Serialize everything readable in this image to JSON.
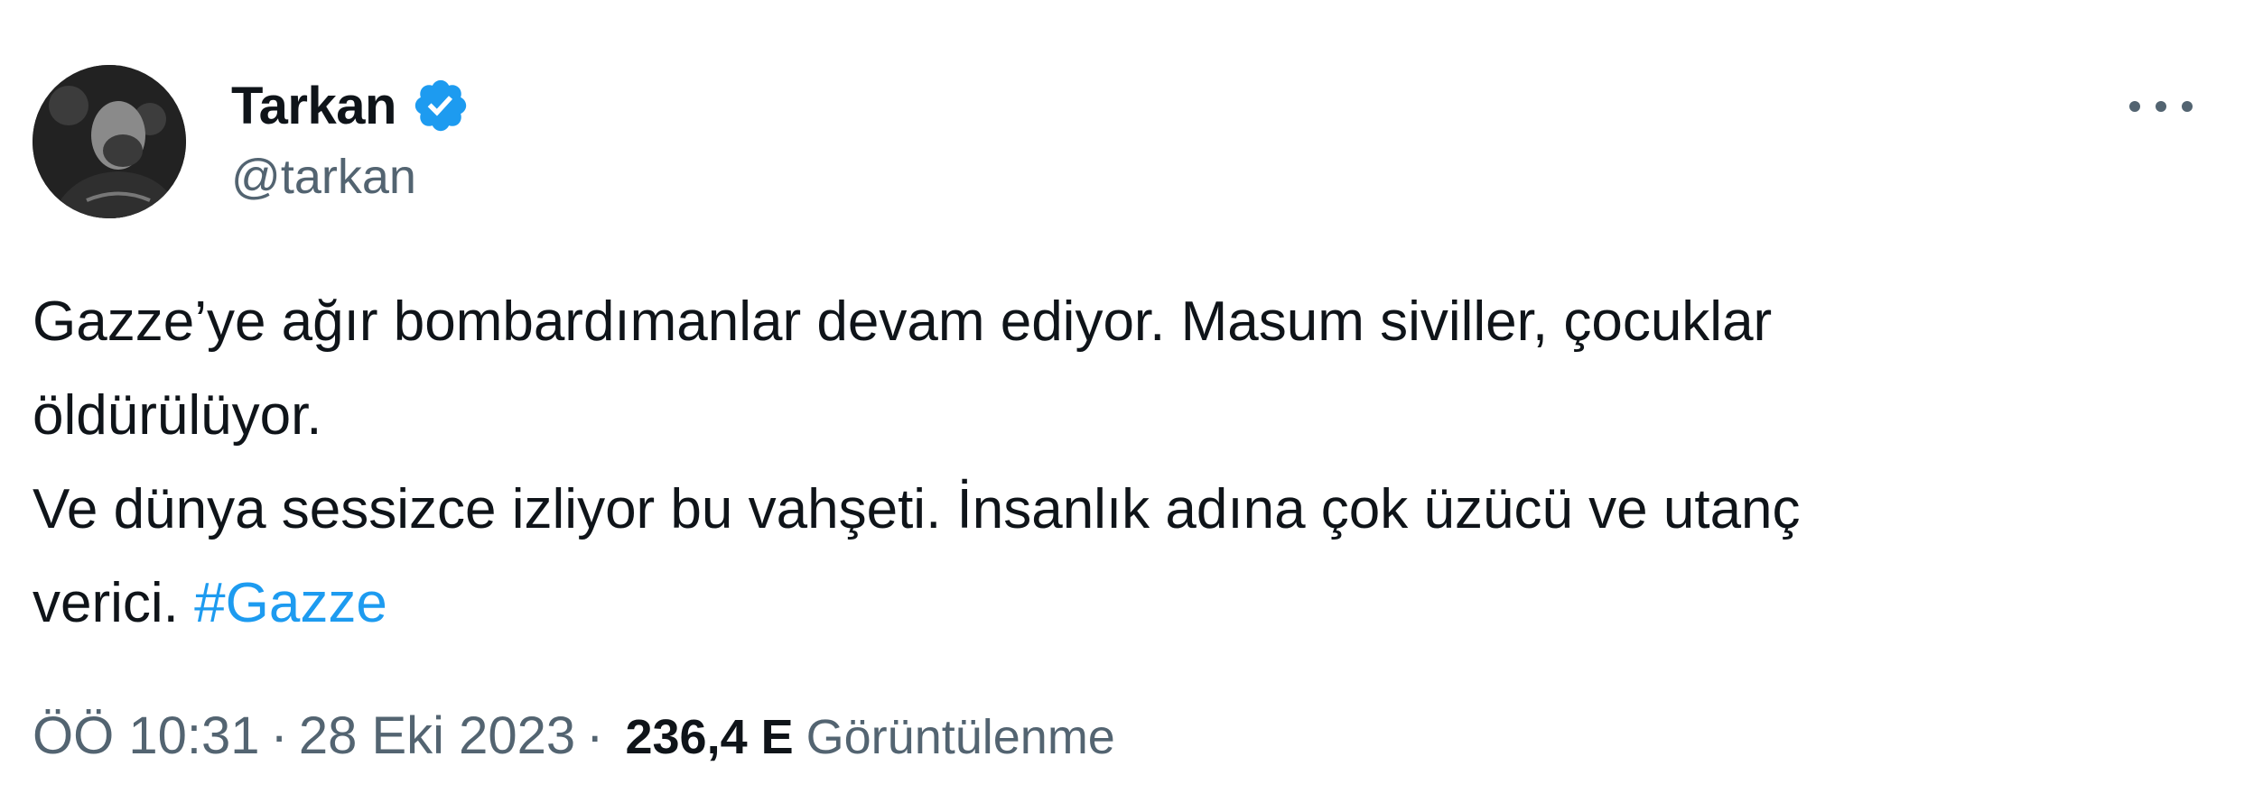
{
  "author": {
    "display_name": "Tarkan",
    "handle": "@tarkan",
    "verified": true,
    "verified_badge_color": "#1d9bf0",
    "avatar_icon": "profile-photo"
  },
  "more_icon": "more-horizontal-icon",
  "tweet": {
    "lines": [
      "Gazze’ye ağır bombardımanlar devam ediyor. Masum siviller, çocuklar",
      "öldürülüyor.",
      "Ve dünya sessizce izliyor bu vahşeti. İnsanlık adına çok üzücü ve utanç"
    ],
    "last_line_text": "verici. ",
    "hashtag": "#Gazze",
    "hashtag_color": "#1d9bf0"
  },
  "meta": {
    "time": "ÖÖ 10:31",
    "separator": "·",
    "date": "28 Eki 2023",
    "views_count": "236,4 E",
    "views_label": "Görüntülenme"
  }
}
